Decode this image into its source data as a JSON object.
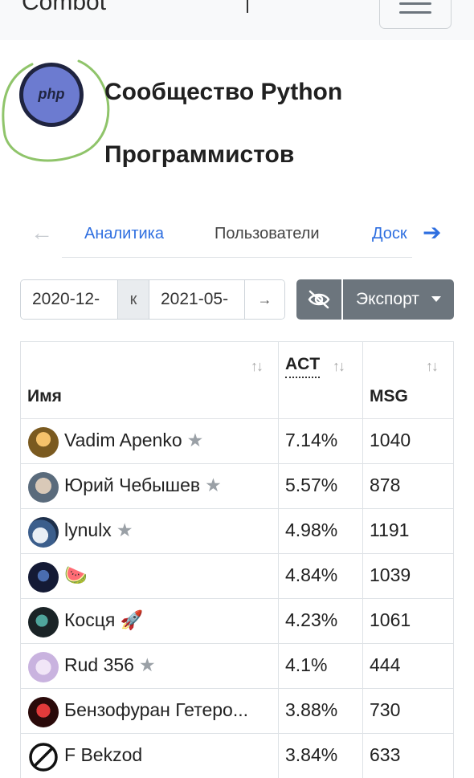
{
  "app": {
    "brand": "Combot"
  },
  "header": {
    "title_line1": "Сообщество Python",
    "title_line2": "Программистов",
    "logo_text": "php"
  },
  "tabs": [
    {
      "label": "Аналитика"
    },
    {
      "label": "Пользователи"
    },
    {
      "label": "Доск"
    }
  ],
  "filters": {
    "date_from": "2020-12-",
    "separator": "к",
    "date_to": "2021-05-",
    "go_arrow": "→",
    "export_label": "Экспорт"
  },
  "table": {
    "headers": {
      "name": "Имя",
      "act": "ACT",
      "msg": "MSG"
    },
    "rows": [
      {
        "name": "Vadim Apenko",
        "star": "★",
        "act": "7.14%",
        "msg": "1040"
      },
      {
        "name": "Юрий Чебышев",
        "star": "★",
        "act": "5.57%",
        "msg": "878"
      },
      {
        "name": "lynulx",
        "star": "★",
        "act": "4.98%",
        "msg": "1191"
      },
      {
        "name": "🍉",
        "star": "",
        "act": "4.84%",
        "msg": "1039"
      },
      {
        "name": "Косця 🚀",
        "star": "",
        "act": "4.23%",
        "msg": "1061"
      },
      {
        "name": "Rud 356",
        "star": "★",
        "act": "4.1%",
        "msg": "444"
      },
      {
        "name": "Бензофуран Гетеро...",
        "star": "",
        "act": "3.88%",
        "msg": "730"
      },
      {
        "name": "F Bekzod",
        "star": "",
        "act": "3.84%",
        "msg": "633"
      }
    ]
  },
  "colors": {
    "link": "#2f6fe0",
    "button_dark": "#6c757d",
    "annotation_circle": "#8fc46a"
  },
  "icons": {
    "sort": "sort-arrows-icon",
    "hide": "eye-slash-icon",
    "star": "star-icon",
    "tab_prev": "arrow-left-icon",
    "tab_next": "arrow-right-icon"
  }
}
